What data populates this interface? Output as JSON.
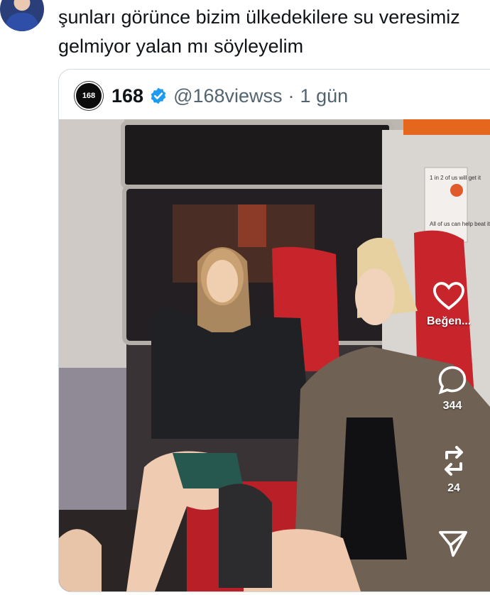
{
  "tweet": {
    "text": "şunları görünce bizim ülkedekilere su veresimiz gelmiyor yalan mı söyleyelim"
  },
  "quoted": {
    "avatar_text": "168",
    "name": "168",
    "verified": true,
    "handle": "@168viewss",
    "separator": "·",
    "time": "1 gün",
    "poster": {
      "line1": "1 in 2 of us will get it",
      "line2": "All of us can help beat it"
    },
    "actions": {
      "like_label": "Beğen...",
      "comments_count": "344",
      "reposts_count": "24"
    },
    "icons": [
      "heart-icon",
      "comment-icon",
      "repost-icon",
      "share-icon",
      "verified-badge-icon"
    ]
  },
  "colors": {
    "verified_blue": "#1d9bf0",
    "seat_red": "#c8242c",
    "border": "#cfd9de",
    "secondary_text": "#536471"
  }
}
